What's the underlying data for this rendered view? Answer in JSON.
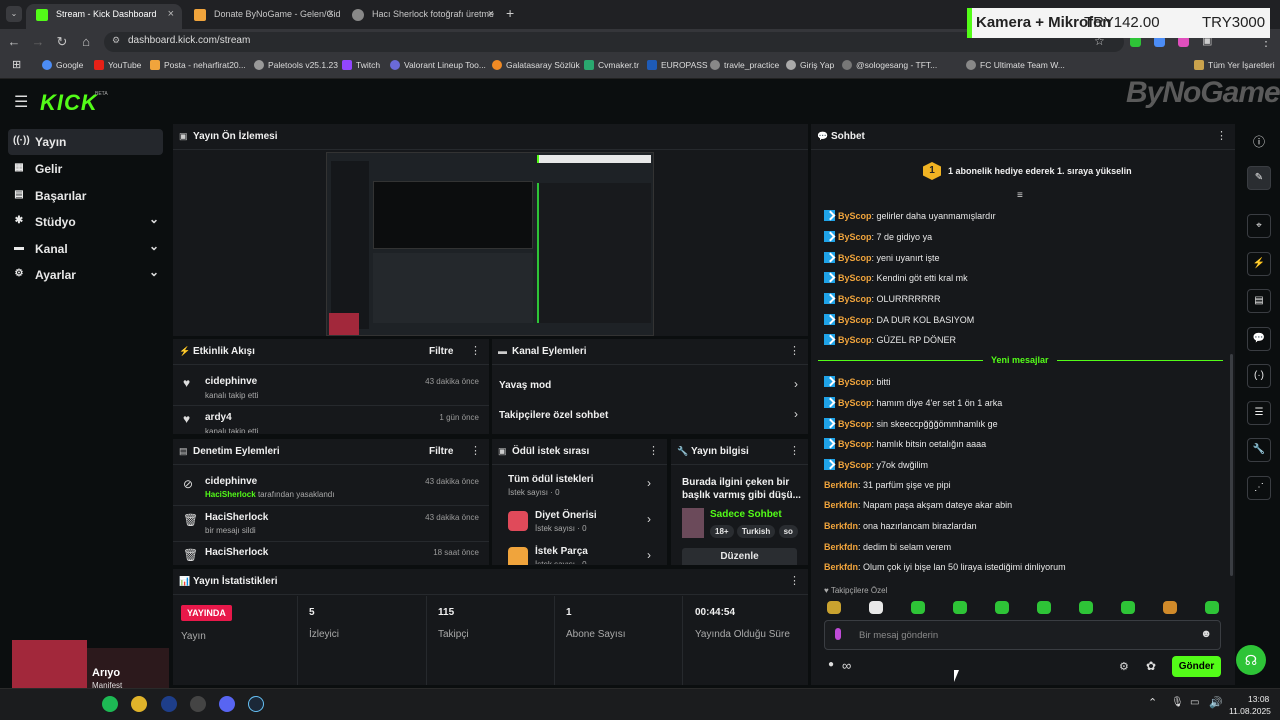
{
  "browser": {
    "tabs": [
      {
        "title": "Stream - Kick Dashboard",
        "active": true,
        "favicon_color": "#53fc18"
      },
      {
        "title": "Donate ByNoGame - Gelen/Gid",
        "active": false,
        "favicon_color": "#f0a43c"
      },
      {
        "title": "Hacı Sherlock fotoğrafı üretme",
        "active": false,
        "favicon_color": "#aaaaaa"
      }
    ],
    "new_tab": "+",
    "url": "dashboard.kick.com/stream",
    "bookmarks": [
      "Google",
      "YouTube",
      "Posta - neharfirat20...",
      "Paletools v25.1.23",
      "Twitch",
      "Valorant Lineup Too...",
      "Galatasaray Sözlük",
      "Cvmaker.tr",
      "EUROPASS",
      "travle_practice",
      "Giriş Yap",
      "@sologesang - TFT...",
      "FC Ultimate Team W..."
    ],
    "all_bookmarks": "Tüm Yer İşaretleri"
  },
  "overlay": {
    "label": "Kamera + Mikrofon",
    "amount": "TRY142.00",
    "goal": "TRY3000"
  },
  "watermark": "ByNoGame",
  "kick": {
    "logo": "KICK",
    "beta": "BETA"
  },
  "sidebar": {
    "items": [
      {
        "label": "Yayın",
        "icon": "broadcast-icon",
        "active": true,
        "expandable": false
      },
      {
        "label": "Gelir",
        "icon": "revenue-icon",
        "active": false,
        "expandable": false
      },
      {
        "label": "Başarılar",
        "icon": "achievements-icon",
        "active": false,
        "expandable": false
      },
      {
        "label": "Stüdyo",
        "icon": "studio-icon",
        "active": false,
        "expandable": true
      },
      {
        "label": "Kanal",
        "icon": "channel-icon",
        "active": false,
        "expandable": true
      },
      {
        "label": "Ayarlar",
        "icon": "settings-icon",
        "active": false,
        "expandable": true
      }
    ]
  },
  "preview": {
    "title": "Yayın Ön İzlemesi"
  },
  "activity": {
    "title": "Etkinlik Akışı",
    "filter": "Filtre",
    "rows": [
      {
        "name": "cidephinve",
        "desc": "kanalı takip etti",
        "time": "43 dakika önce"
      },
      {
        "name": "ardy4",
        "desc": "kanalı takip etti",
        "time": "1 gün önce"
      }
    ]
  },
  "channel_actions": {
    "title": "Kanal Eylemleri",
    "items": [
      "Yavaş mod",
      "Takipçilere özel sohbet"
    ]
  },
  "moderation": {
    "title": "Denetim Eylemleri",
    "filter": "Filtre",
    "rows": [
      {
        "name": "cidephinve",
        "actor": "HaciSherlock",
        "desc": "tarafından yasaklandı",
        "time": "43 dakika önce"
      },
      {
        "name": "HaciSherlock",
        "actor": "",
        "desc": "bir mesajı sildi",
        "time": "43 dakika önce"
      },
      {
        "name": "HaciSherlock",
        "actor": "",
        "desc": "",
        "time": "18 saat önce"
      }
    ]
  },
  "rewards": {
    "title": "Ödül istek sırası",
    "items": [
      {
        "name": "Tüm ödül istekleri",
        "count": "İstek sayısı · 0"
      },
      {
        "name": "Diyet Önerisi",
        "count": "İstek sayısı · 0"
      },
      {
        "name": "İstek Parça",
        "count": "İstek sayısı · 0"
      }
    ]
  },
  "stream_info": {
    "title": "Yayın bilgisi",
    "stream_title": "Burada ilgini çeken bir başlık varmış gibi düşü...",
    "category": "Sadece Sohbet",
    "tags": [
      "18+",
      "Turkish",
      "so"
    ],
    "edit": "Düzenle"
  },
  "stats": {
    "title": "Yayın İstatistikleri",
    "live_badge": "YAYINDA",
    "live_label": "Yayın",
    "items": [
      {
        "value": "5",
        "label": "İzleyici"
      },
      {
        "value": "115",
        "label": "Takipçi"
      },
      {
        "value": "1",
        "label": "Abone Sayısı"
      },
      {
        "value": "00:44:54",
        "label": "Yayında Olduğu Süre"
      }
    ]
  },
  "chat": {
    "title": "Sohbet",
    "gift_rank": "1",
    "gift_banner": "1 abonelik hediye ederek 1. sıraya yükselin",
    "messages_old": [
      {
        "user": "ByScop",
        "text": "gelirler daha uyanmamışlardır"
      },
      {
        "user": "ByScop",
        "text": "7 de gidiyo ya"
      },
      {
        "user": "ByScop",
        "text": "yeni uyanırt işte"
      },
      {
        "user": "ByScop",
        "text": "Kendini göt etti kral mk"
      },
      {
        "user": "ByScop",
        "text": "OLURRRRRRR"
      },
      {
        "user": "ByScop",
        "text": "DA DUR KOL BASIYOM"
      },
      {
        "user": "ByScop",
        "text": "GÜZEL RP DÖNER"
      }
    ],
    "new_messages_label": "Yeni mesajlar",
    "messages_new": [
      {
        "user": "ByScop",
        "text": "bitti",
        "badge": true
      },
      {
        "user": "ByScop",
        "text": "hamım diye 4'er set 1 ön 1 arka",
        "badge": true
      },
      {
        "user": "ByScop",
        "text": "sin skeeccpğğğömmhamlık ge",
        "badge": true
      },
      {
        "user": "ByScop",
        "text": "hamlık bitsin oetalığın aaaa",
        "badge": true
      },
      {
        "user": "ByScop",
        "text": "y7ok dwğilim",
        "badge": true
      },
      {
        "user": "Berkfdn",
        "text": "31 parfüm şişe ve pipi",
        "badge": false
      },
      {
        "user": "Berkfdn",
        "text": "Napam paşa akşam dateye akar abin",
        "badge": false
      },
      {
        "user": "Berkfdn",
        "text": "ona hazırlancam birazlardan",
        "badge": false
      },
      {
        "user": "Berkfdn",
        "text": "dedim bi selam verem",
        "badge": false
      },
      {
        "user": "Berkfdn",
        "text": "Olum çok iyi bişe lan 50 liraya istediğimi dinliyorum",
        "badge": false
      }
    ],
    "followers_only": "Takipçilere Özel",
    "input_placeholder": "Bir mesaj gönderin",
    "send": "Gönder",
    "points": "∞"
  },
  "media": {
    "title": "Arıyo",
    "subtitle": "Manifest"
  },
  "clock": {
    "time": "13:08",
    "date": "11.08.2025"
  }
}
